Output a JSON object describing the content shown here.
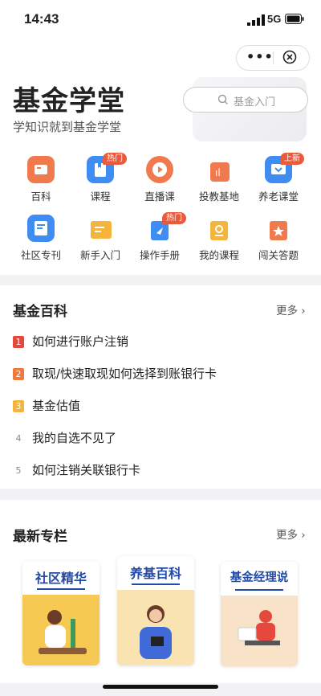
{
  "status_bar": {
    "time": "14:43",
    "network": "5G"
  },
  "header": {
    "title": "基金学堂",
    "subtitle": "学知识就到基金学堂",
    "search_placeholder": "基金入门"
  },
  "grid": [
    {
      "label": "百科",
      "icon": "encyclopedia-icon",
      "color": "#f07a4e",
      "badge": ""
    },
    {
      "label": "课程",
      "icon": "course-icon",
      "color": "#3f8cf2",
      "badge": "热门"
    },
    {
      "label": "直播课",
      "icon": "live-play-icon",
      "color": "#f07a4e",
      "badge": ""
    },
    {
      "label": "投教基地",
      "icon": "education-base-icon",
      "color": "#f07a4e",
      "badge": ""
    },
    {
      "label": "养老课堂",
      "icon": "retirement-class-icon",
      "color": "#3f8cf2",
      "badge": "上新"
    },
    {
      "label": "社区专刊",
      "icon": "community-journal-icon",
      "color": "#3f8cf2",
      "badge": ""
    },
    {
      "label": "新手入门",
      "icon": "beginner-icon",
      "color": "#f5b53c",
      "badge": ""
    },
    {
      "label": "操作手册",
      "icon": "manual-icon",
      "color": "#3f8cf2",
      "badge": "热门"
    },
    {
      "label": "我的课程",
      "icon": "my-course-icon",
      "color": "#f5b53c",
      "badge": ""
    },
    {
      "label": "闯关答题",
      "icon": "quiz-icon",
      "color": "#f07a4e",
      "badge": ""
    }
  ],
  "encyclopedia": {
    "title": "基金百科",
    "more": "更多",
    "items": [
      {
        "rank": "1",
        "text": "如何进行账户注销",
        "color": "#e5483c"
      },
      {
        "rank": "2",
        "text": "取现/快速取现如何选择到账银行卡",
        "color": "#f07a3c"
      },
      {
        "rank": "3",
        "text": "基金估值",
        "color": "#f5b53c"
      },
      {
        "rank": "4",
        "text": "我的自选不见了",
        "color": ""
      },
      {
        "rank": "5",
        "text": "如何注销关联银行卡",
        "color": ""
      }
    ]
  },
  "columns": {
    "title": "最新专栏",
    "more": "更多",
    "books": [
      {
        "title": "社区精华"
      },
      {
        "title": "养基百科"
      },
      {
        "title": "基金经理说"
      }
    ]
  }
}
